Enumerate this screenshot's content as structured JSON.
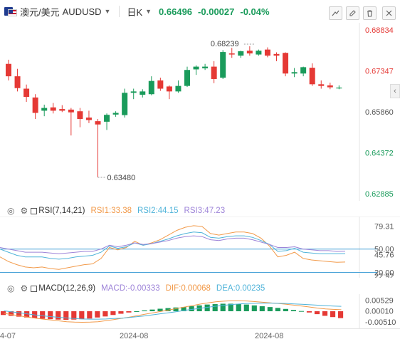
{
  "header": {
    "symbol_name": "澳元/美元",
    "symbol_code": "AUDUSD",
    "dropdown_caret": "▼",
    "period": "日K",
    "period_caret": "▼",
    "last_price": "0.66496",
    "change": "-0.00027",
    "change_percent": "-0.04%"
  },
  "toolbar_icons": [
    "draw-line-icon",
    "pen-icon",
    "trash-icon",
    "collapse-icon",
    "close-icon"
  ],
  "price_axis": [
    "0.68834",
    "0.67347",
    "0.65860",
    "0.64372",
    "0.62885"
  ],
  "annotations": {
    "high": "0.68239",
    "low": "0.63480"
  },
  "rsi": {
    "title": "RSI(7,14,21)",
    "rsi1": "RSI1:33.38",
    "rsi2": "RSI2:44.15",
    "rsi3": "RSI3:47.23",
    "axis": [
      "79.31",
      "50.00",
      "45.76",
      "20.00",
      "22.92"
    ]
  },
  "macd": {
    "title": "MACD(12,26,9)",
    "macd": "MACD:-0.00333",
    "dif": "DIF:0.00068",
    "dea": "DEA:0.00235",
    "axis": [
      "0.00529",
      "0.00010",
      "-0.00510"
    ]
  },
  "time_axis": [
    "4-07",
    "2024-08",
    "2024-08"
  ],
  "colors": {
    "up": "#1a9b5b",
    "down": "#e53935",
    "rsi1": "#f29a4a",
    "rsi2": "#4fb3d9",
    "rsi3": "#9d83d8",
    "level_line": "#4aa3d8"
  },
  "chart_data": [
    {
      "type": "candlestick",
      "title": "",
      "ylim": [
        0.62885,
        0.68834
      ],
      "y_ticks": [
        0.68834,
        0.67347,
        0.6586,
        0.64372,
        0.62885
      ],
      "candles": [
        {
          "o": 0.676,
          "h": 0.6775,
          "l": 0.67,
          "c": 0.6715
        },
        {
          "o": 0.6715,
          "h": 0.6742,
          "l": 0.666,
          "c": 0.6672
        },
        {
          "o": 0.667,
          "h": 0.6685,
          "l": 0.6622,
          "c": 0.664
        },
        {
          "o": 0.6638,
          "h": 0.665,
          "l": 0.656,
          "c": 0.6582
        },
        {
          "o": 0.659,
          "h": 0.6612,
          "l": 0.657,
          "c": 0.66
        },
        {
          "o": 0.6602,
          "h": 0.6618,
          "l": 0.658,
          "c": 0.659
        },
        {
          "o": 0.6596,
          "h": 0.661,
          "l": 0.6585,
          "c": 0.659
        },
        {
          "o": 0.6594,
          "h": 0.66,
          "l": 0.65,
          "c": 0.6584
        },
        {
          "o": 0.6588,
          "h": 0.66,
          "l": 0.653,
          "c": 0.656
        },
        {
          "o": 0.6565,
          "h": 0.659,
          "l": 0.6545,
          "c": 0.6556
        },
        {
          "o": 0.6552,
          "h": 0.656,
          "l": 0.6348,
          "c": 0.654
        },
        {
          "o": 0.655,
          "h": 0.658,
          "l": 0.652,
          "c": 0.6575
        },
        {
          "o": 0.6576,
          "h": 0.6588,
          "l": 0.6568,
          "c": 0.6582
        },
        {
          "o": 0.6574,
          "h": 0.667,
          "l": 0.6565,
          "c": 0.6655
        },
        {
          "o": 0.6655,
          "h": 0.667,
          "l": 0.6632,
          "c": 0.666
        },
        {
          "o": 0.6648,
          "h": 0.6668,
          "l": 0.6638,
          "c": 0.666
        },
        {
          "o": 0.665,
          "h": 0.6715,
          "l": 0.6646,
          "c": 0.6698
        },
        {
          "o": 0.67,
          "h": 0.671,
          "l": 0.6662,
          "c": 0.667
        },
        {
          "o": 0.6678,
          "h": 0.6682,
          "l": 0.6632,
          "c": 0.666
        },
        {
          "o": 0.666,
          "h": 0.67,
          "l": 0.6655,
          "c": 0.668
        },
        {
          "o": 0.668,
          "h": 0.675,
          "l": 0.6676,
          "c": 0.6738
        },
        {
          "o": 0.674,
          "h": 0.6755,
          "l": 0.672,
          "c": 0.675
        },
        {
          "o": 0.6744,
          "h": 0.676,
          "l": 0.6738,
          "c": 0.675
        },
        {
          "o": 0.675,
          "h": 0.677,
          "l": 0.669,
          "c": 0.6705
        },
        {
          "o": 0.671,
          "h": 0.681,
          "l": 0.6705,
          "c": 0.6803
        },
        {
          "o": 0.6798,
          "h": 0.6818,
          "l": 0.6782,
          "c": 0.6794
        },
        {
          "o": 0.679,
          "h": 0.6808,
          "l": 0.6782,
          "c": 0.6806
        },
        {
          "o": 0.6808,
          "h": 0.6824,
          "l": 0.679,
          "c": 0.6798
        },
        {
          "o": 0.6794,
          "h": 0.6812,
          "l": 0.679,
          "c": 0.6808
        },
        {
          "o": 0.6812,
          "h": 0.682,
          "l": 0.6784,
          "c": 0.679
        },
        {
          "o": 0.6796,
          "h": 0.6802,
          "l": 0.677,
          "c": 0.679
        },
        {
          "o": 0.68,
          "h": 0.6802,
          "l": 0.6715,
          "c": 0.6725
        },
        {
          "o": 0.6725,
          "h": 0.6745,
          "l": 0.6712,
          "c": 0.673
        },
        {
          "o": 0.6725,
          "h": 0.675,
          "l": 0.6715,
          "c": 0.6748
        },
        {
          "o": 0.6746,
          "h": 0.6762,
          "l": 0.668,
          "c": 0.6686
        },
        {
          "o": 0.6686,
          "h": 0.67,
          "l": 0.667,
          "c": 0.668
        },
        {
          "o": 0.6682,
          "h": 0.6692,
          "l": 0.6668,
          "c": 0.6675
        },
        {
          "o": 0.6672,
          "h": 0.6682,
          "l": 0.6668,
          "c": 0.6674
        }
      ]
    },
    {
      "type": "line",
      "title": "RSI(7,14,21)",
      "ylim": [
        15,
        90
      ],
      "levels": [
        50,
        20
      ],
      "series": [
        {
          "name": "RSI1",
          "values": [
            40,
            34,
            30,
            27,
            26,
            27,
            25,
            24,
            26,
            28,
            30,
            31,
            38,
            52,
            49,
            52,
            60,
            55,
            58,
            62,
            68,
            74,
            78,
            80,
            79,
            70,
            68,
            70,
            72,
            72,
            70,
            64,
            54,
            40,
            42,
            46,
            38,
            36,
            35,
            34,
            33,
            33.4
          ]
        },
        {
          "name": "RSI2",
          "values": [
            50,
            46,
            42,
            40,
            40,
            40,
            38,
            37,
            38,
            40,
            41,
            42,
            46,
            54,
            51,
            53,
            58,
            55,
            57,
            60,
            63,
            67,
            70,
            72,
            71,
            65,
            64,
            66,
            67,
            67,
            65,
            61,
            56,
            47,
            48,
            51,
            46,
            45,
            44,
            44,
            44,
            44.2
          ]
        },
        {
          "name": "RSI3",
          "values": [
            52,
            50,
            48,
            46,
            46,
            46,
            45,
            44,
            45,
            46,
            47,
            47,
            50,
            55,
            53,
            55,
            58,
            56,
            57,
            59,
            61,
            64,
            66,
            67,
            66,
            62,
            61,
            63,
            64,
            64,
            62,
            59,
            56,
            52,
            52,
            53,
            50,
            49,
            48,
            48,
            47,
            47.2
          ]
        }
      ]
    },
    {
      "type": "bar",
      "title": "MACD(12,26,9)",
      "ylim": [
        -0.0075,
        0.0075
      ],
      "series": [
        {
          "name": "MACD",
          "values": [
            -0.0018,
            -0.0022,
            -0.0026,
            -0.003,
            -0.0033,
            -0.0036,
            -0.0038,
            -0.004,
            -0.0041,
            -0.004,
            -0.0038,
            -0.0035,
            -0.003,
            -0.0025,
            -0.0018,
            -0.0012,
            -0.0006,
            0,
            0.0004,
            0.0008,
            0.0012,
            0.0015,
            0.0018,
            0.002,
            0.0024,
            0.0028,
            0.0032,
            0.0034,
            0.0036,
            0.0036,
            0.0035,
            0.0032,
            0.0028,
            0.0024,
            0.002,
            0.0016,
            0.0011,
            0.0006,
            0.0001,
            -0.0006,
            -0.0014,
            -0.0022,
            -0.0028,
            -0.0033
          ]
        },
        {
          "name": "DIF",
          "values": [
            -0.001,
            -0.0016,
            -0.0022,
            -0.0028,
            -0.0033,
            -0.0038,
            -0.0042,
            -0.0046,
            -0.005,
            -0.0052,
            -0.0053,
            -0.0052,
            -0.005,
            -0.0045,
            -0.004,
            -0.0034,
            -0.0028,
            -0.0021,
            -0.0014,
            -0.0008,
            -0.0001,
            0.0006,
            0.0013,
            0.002,
            0.0027,
            0.0034,
            0.004,
            0.0045,
            0.0048,
            0.005,
            0.005,
            0.0049,
            0.0046,
            0.0043,
            0.004,
            0.0037,
            0.0033,
            0.0029,
            0.0025,
            0.002,
            0.0015,
            0.0011,
            0.0009,
            0.0007
          ]
        },
        {
          "name": "DEA",
          "values": [
            0.0002,
            -0.0003,
            -0.0008,
            -0.0013,
            -0.0018,
            -0.0022,
            -0.0026,
            -0.0029,
            -0.0032,
            -0.0035,
            -0.0037,
            -0.0038,
            -0.0038,
            -0.0037,
            -0.0035,
            -0.0033,
            -0.003,
            -0.0026,
            -0.0022,
            -0.0017,
            -0.0012,
            -0.0007,
            -0.0002,
            0.0004,
            0.0009,
            0.0014,
            0.0019,
            0.0024,
            0.0028,
            0.0032,
            0.0035,
            0.0037,
            0.0038,
            0.0039,
            0.0039,
            0.0038,
            0.0037,
            0.0035,
            0.0033,
            0.0031,
            0.0029,
            0.0027,
            0.0025,
            0.00235
          ]
        }
      ]
    }
  ]
}
